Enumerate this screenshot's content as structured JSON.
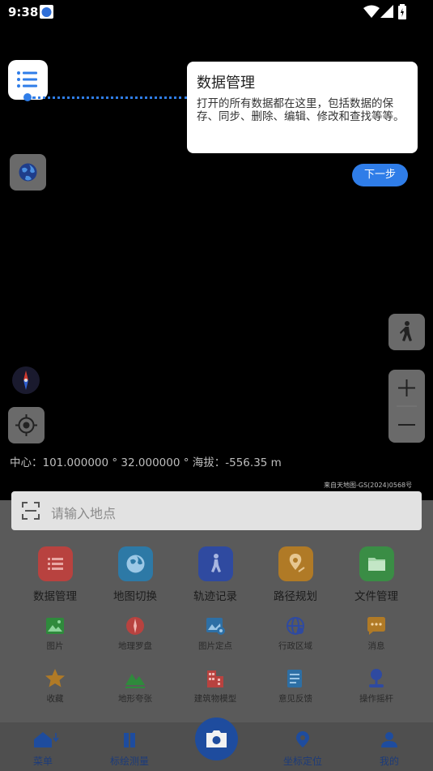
{
  "status_bar": {
    "time": "9:38"
  },
  "tooltip": {
    "title": "数据管理",
    "description": "打开的所有数据都在这里，包括数据的保存、同步、删除、编辑、修改和查找等等。",
    "next_label": "下一步"
  },
  "map": {
    "coordinates": "中心：101.000000 ° 32.000000 ° 海拔：-556.35 m",
    "credit": "来自天地图-GS(2024)0568号"
  },
  "search": {
    "placeholder": "请输入地点"
  },
  "main_tools": [
    {
      "label": "数据管理",
      "icon": "list-icon",
      "color": "#b8423f"
    },
    {
      "label": "地图切换",
      "icon": "globe-icon",
      "color": "#2d79a6"
    },
    {
      "label": "轨迹记录",
      "icon": "walker-icon",
      "color": "#2f4aa0"
    },
    {
      "label": "路径规划",
      "icon": "route-icon",
      "color": "#b07a26"
    },
    {
      "label": "文件管理",
      "icon": "folder-icon",
      "color": "#3a8d45"
    }
  ],
  "tools_row1": [
    {
      "label": "图片",
      "icon": "image-icon"
    },
    {
      "label": "地理罗盘",
      "icon": "compass-icon"
    },
    {
      "label": "图片定点",
      "icon": "image-pin-icon"
    },
    {
      "label": "行政区域",
      "icon": "region-icon"
    },
    {
      "label": "消息",
      "icon": "message-icon"
    }
  ],
  "tools_row2": [
    {
      "label": "收藏",
      "icon": "star-icon"
    },
    {
      "label": "地形夸张",
      "icon": "terrain-icon"
    },
    {
      "label": "建筑物模型",
      "icon": "building-icon"
    },
    {
      "label": "意见反馈",
      "icon": "feedback-icon"
    },
    {
      "label": "操作摇杆",
      "icon": "joystick-icon"
    }
  ],
  "nav": [
    {
      "label": "菜单",
      "icon": "home-icon"
    },
    {
      "label": "标绘测量",
      "icon": "measure-icon"
    },
    {
      "label": "坐标定位",
      "icon": "location-icon"
    },
    {
      "label": "我的",
      "icon": "user-icon"
    }
  ],
  "colors": {
    "accent": "#2f7de8",
    "sheet": "#5a5a5a"
  }
}
